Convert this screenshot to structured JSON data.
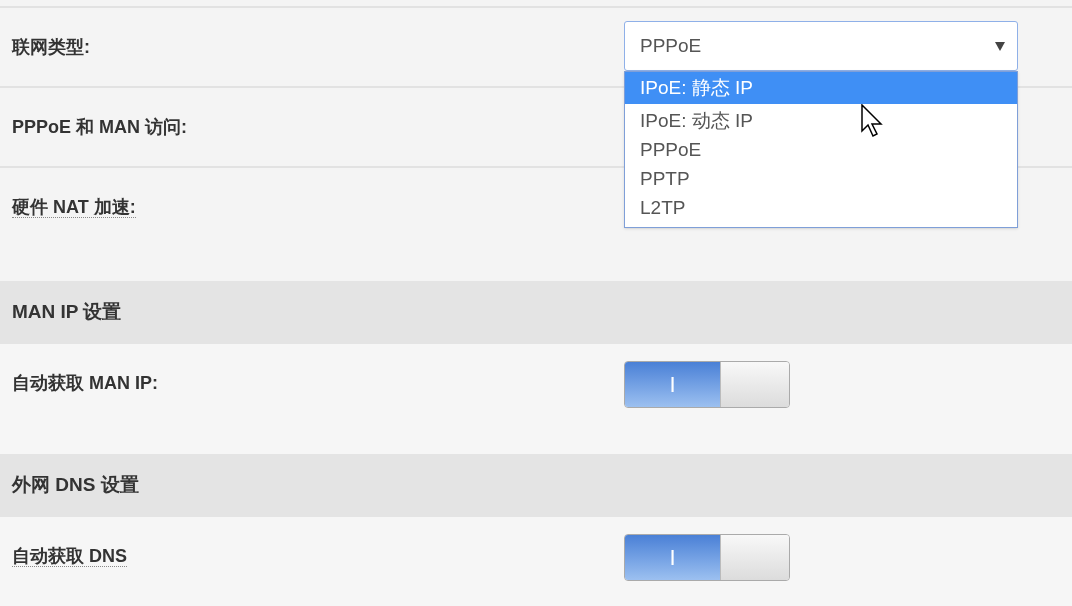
{
  "rows": [
    {
      "kind": "select",
      "label": "联网类型:",
      "hint": false,
      "value": "PPPoE",
      "expanded": true,
      "options": [
        {
          "label": "IPoE: 静态 IP",
          "highlighted": true
        },
        {
          "label": "IPoE: 动态 IP",
          "highlighted": false
        },
        {
          "label": "PPPoE",
          "highlighted": false
        },
        {
          "label": "PPTP",
          "highlighted": false
        },
        {
          "label": "L2TP",
          "highlighted": false
        }
      ]
    },
    {
      "kind": "blank",
      "label": "PPPoE 和 MAN 访问:",
      "hint": false
    },
    {
      "kind": "blank",
      "label": "硬件 NAT 加速:",
      "hint": true
    },
    {
      "kind": "header",
      "label": "MAN IP 设置"
    },
    {
      "kind": "toggle",
      "label": "自动获取 MAN IP:",
      "hint": false,
      "on": true,
      "on_label": "I"
    },
    {
      "kind": "header",
      "label": "外网 DNS 设置"
    },
    {
      "kind": "toggle",
      "label": "自动获取 DNS",
      "hint": true,
      "on": true,
      "on_label": "I"
    }
  ]
}
